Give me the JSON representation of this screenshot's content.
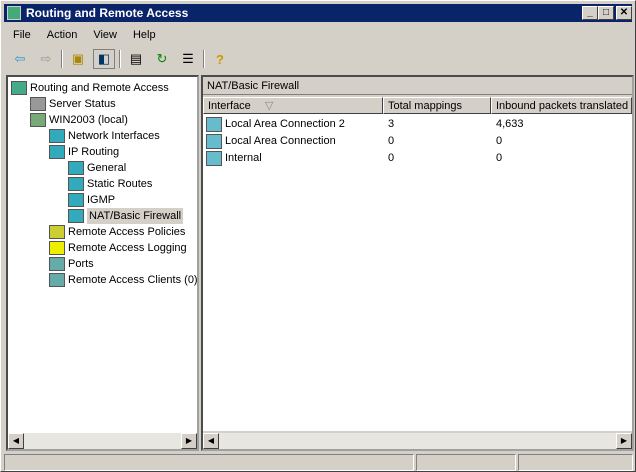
{
  "window": {
    "title": "Routing and Remote Access",
    "min": "_",
    "max": "□",
    "close": "✕"
  },
  "menu": [
    "File",
    "Action",
    "View",
    "Help"
  ],
  "tree": [
    {
      "label": "Routing and Remote Access",
      "level": 0,
      "icon": "computer-icon"
    },
    {
      "label": "Server Status",
      "level": 1,
      "icon": "server-status-icon"
    },
    {
      "label": "WIN2003 (local)",
      "level": 1,
      "icon": "server-icon"
    },
    {
      "label": "Network Interfaces",
      "level": 2,
      "icon": "network-interfaces-icon"
    },
    {
      "label": "IP Routing",
      "level": 2,
      "icon": "ip-routing-icon"
    },
    {
      "label": "General",
      "level": 3,
      "icon": "routing-icon"
    },
    {
      "label": "Static Routes",
      "level": 3,
      "icon": "routing-icon"
    },
    {
      "label": "IGMP",
      "level": 3,
      "icon": "routing-icon"
    },
    {
      "label": "NAT/Basic Firewall",
      "level": 3,
      "icon": "routing-icon",
      "selected": true
    },
    {
      "label": "Remote Access Policies",
      "level": 2,
      "icon": "policies-icon"
    },
    {
      "label": "Remote Access Logging",
      "level": 2,
      "icon": "folder-icon"
    },
    {
      "label": "Ports",
      "level": 2,
      "icon": "ports-icon"
    },
    {
      "label": "Remote Access Clients (0)",
      "level": 2,
      "icon": "clients-icon"
    }
  ],
  "right": {
    "header": "NAT/Basic Firewall",
    "columns": [
      "Interface",
      "Total mappings",
      "Inbound packets translated"
    ],
    "rows": [
      [
        "Local Area Connection 2",
        "3",
        "4,633"
      ],
      [
        "Local Area Connection",
        "0",
        "0"
      ],
      [
        "Internal",
        "0",
        "0"
      ]
    ]
  }
}
